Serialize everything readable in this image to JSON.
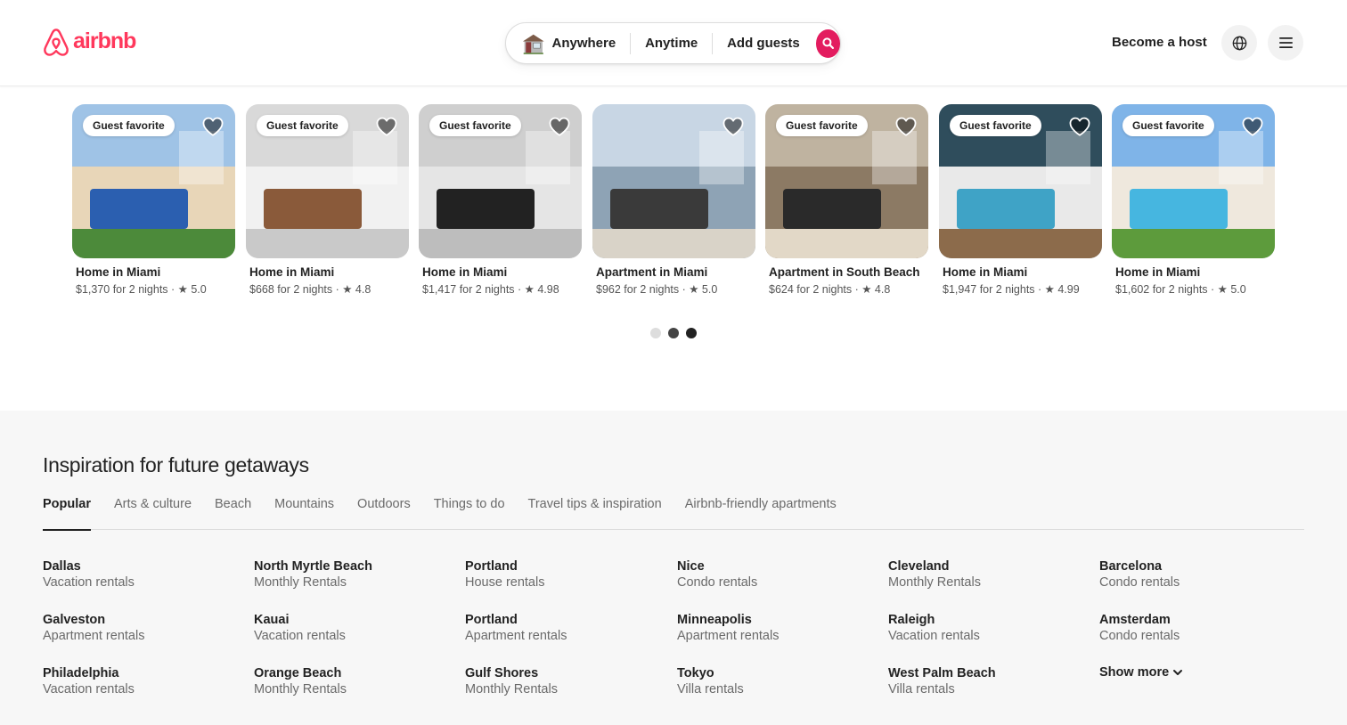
{
  "header": {
    "brand": "airbnb",
    "search": {
      "where": "Anywhere",
      "when": "Anytime",
      "who": "Add guests"
    },
    "become_host": "Become a host"
  },
  "listings": [
    {
      "badge": "Guest favorite",
      "title": "Home in Miami",
      "price_rating": "$1,370 for 2 nights · ★ 5.0"
    },
    {
      "badge": "Guest favorite",
      "title": "Home in Miami",
      "price_rating": "$668 for 2 nights · ★ 4.8"
    },
    {
      "badge": "Guest favorite",
      "title": "Home in Miami",
      "price_rating": "$1,417 for 2 nights · ★ 4.98"
    },
    {
      "badge": "",
      "title": "Apartment in Miami",
      "price_rating": "$962 for 2 nights · ★ 5.0"
    },
    {
      "badge": "Guest favorite",
      "title": "Apartment in South Beach",
      "price_rating": "$624 for 2 nights · ★ 4.8"
    },
    {
      "badge": "Guest favorite",
      "title": "Home in Miami",
      "price_rating": "$1,947 for 2 nights · ★ 4.99"
    },
    {
      "badge": "Guest favorite",
      "title": "Home in Miami",
      "price_rating": "$1,602 for 2 nights · ★ 5.0"
    }
  ],
  "carousel": {
    "page_count": 3,
    "active_page": 3
  },
  "inspiration": {
    "title": "Inspiration for future getaways",
    "tabs": [
      "Popular",
      "Arts & culture",
      "Beach",
      "Mountains",
      "Outdoors",
      "Things to do",
      "Travel tips & inspiration",
      "Airbnb-friendly apartments"
    ],
    "active_tab": "Popular",
    "columns": [
      [
        {
          "name": "Dallas",
          "type": "Vacation rentals"
        },
        {
          "name": "Galveston",
          "type": "Apartment rentals"
        },
        {
          "name": "Philadelphia",
          "type": "Vacation rentals"
        }
      ],
      [
        {
          "name": "North Myrtle Beach",
          "type": "Monthly Rentals"
        },
        {
          "name": "Kauai",
          "type": "Vacation rentals"
        },
        {
          "name": "Orange Beach",
          "type": "Monthly Rentals"
        }
      ],
      [
        {
          "name": "Portland",
          "type": "House rentals"
        },
        {
          "name": "Portland",
          "type": "Apartment rentals"
        },
        {
          "name": "Gulf Shores",
          "type": "Monthly Rentals"
        }
      ],
      [
        {
          "name": "Nice",
          "type": "Condo rentals"
        },
        {
          "name": "Minneapolis",
          "type": "Apartment rentals"
        },
        {
          "name": "Tokyo",
          "type": "Villa rentals"
        }
      ],
      [
        {
          "name": "Cleveland",
          "type": "Monthly Rentals"
        },
        {
          "name": "Raleigh",
          "type": "Vacation rentals"
        },
        {
          "name": "West Palm Beach",
          "type": "Villa rentals"
        }
      ],
      [
        {
          "name": "Barcelona",
          "type": "Condo rentals"
        },
        {
          "name": "Amsterdam",
          "type": "Condo rentals"
        }
      ]
    ],
    "show_more": "Show more"
  },
  "colors": {
    "brand": "#ff385c",
    "search_button": "#e31c5f",
    "text_primary": "#222222",
    "text_secondary": "#6a6a6a",
    "section_bg": "#f7f7f7"
  },
  "icons": [
    "airbnb-logo-icon",
    "house-icon",
    "search-icon",
    "globe-icon",
    "hamburger-menu-icon",
    "heart-icon",
    "chevron-down-icon"
  ]
}
